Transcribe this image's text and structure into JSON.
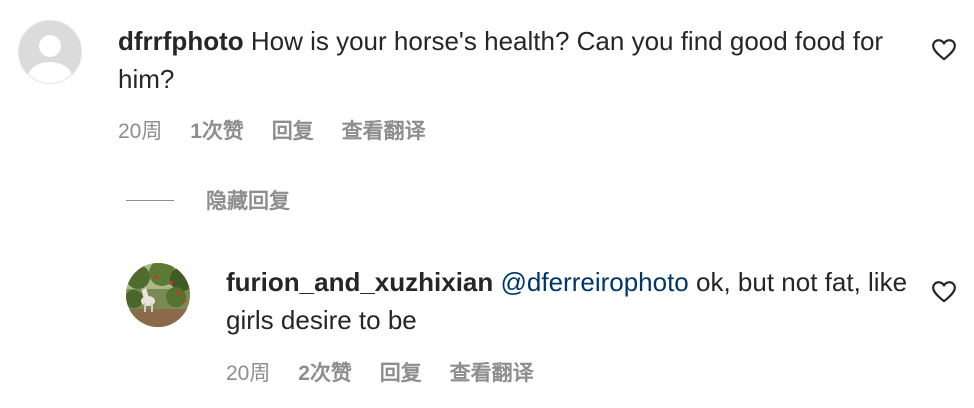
{
  "comments": [
    {
      "username": "dfrrfphoto",
      "text": "How is your horse's health? Can you find good food for him?",
      "time": "20周",
      "likes": "1次赞",
      "reply_label": "回复",
      "translate_label": "查看翻译"
    },
    {
      "username": "furion_and_xuzhixian",
      "mention": "@dferreirophoto",
      "text": "ok, but not fat, like girls desire to be",
      "time": "20周",
      "likes": "2次赞",
      "reply_label": "回复",
      "translate_label": "查看翻译"
    }
  ],
  "hide_replies_label": "隐藏回复",
  "icons": {
    "like": "heart-outline-icon",
    "avatar_default": "default-avatar-icon"
  },
  "colors": {
    "username": "#262626",
    "meta": "#8e8e8e",
    "mention": "#00376b"
  }
}
